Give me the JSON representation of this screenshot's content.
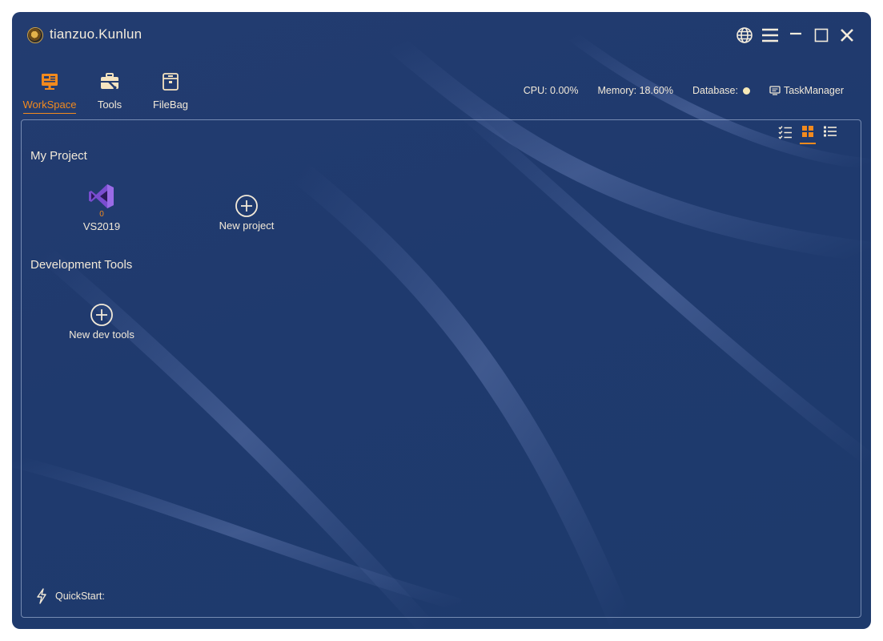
{
  "app": {
    "title": "tianzuo.Kunlun",
    "logo_icon": "app-logo-icon"
  },
  "window_controls": [
    "globe-icon",
    "menu-icon",
    "minimize-icon",
    "maximize-icon",
    "close-icon"
  ],
  "nav": {
    "items": [
      {
        "label": "WorkSpace",
        "icon": "workspace-icon",
        "active": true
      },
      {
        "label": "Tools",
        "icon": "toolbox-icon",
        "active": false
      },
      {
        "label": "FileBag",
        "icon": "filebag-icon",
        "active": false
      }
    ]
  },
  "status": {
    "cpu": "CPU: 0.00%",
    "memory": "Memory: 18.60%",
    "database": "Database:",
    "task_manager": "TaskManager"
  },
  "view_modes": [
    {
      "icon": "checklist-view-icon",
      "active": false
    },
    {
      "icon": "grid-view-icon",
      "active": true
    },
    {
      "icon": "list-view-icon",
      "active": false
    }
  ],
  "sections": {
    "my_project": {
      "title": "My Project",
      "items": [
        {
          "label": "VS2019",
          "count": "0",
          "icon": "visual-studio-icon"
        }
      ],
      "add_label": "New project"
    },
    "dev_tools": {
      "title": "Development Tools",
      "add_label": "New dev tools"
    }
  },
  "quickstart": {
    "label": "QuickStart:"
  },
  "colors": {
    "accent": "#f28a1e",
    "background": "#1f3a6e",
    "text": "#f2e9d8"
  }
}
